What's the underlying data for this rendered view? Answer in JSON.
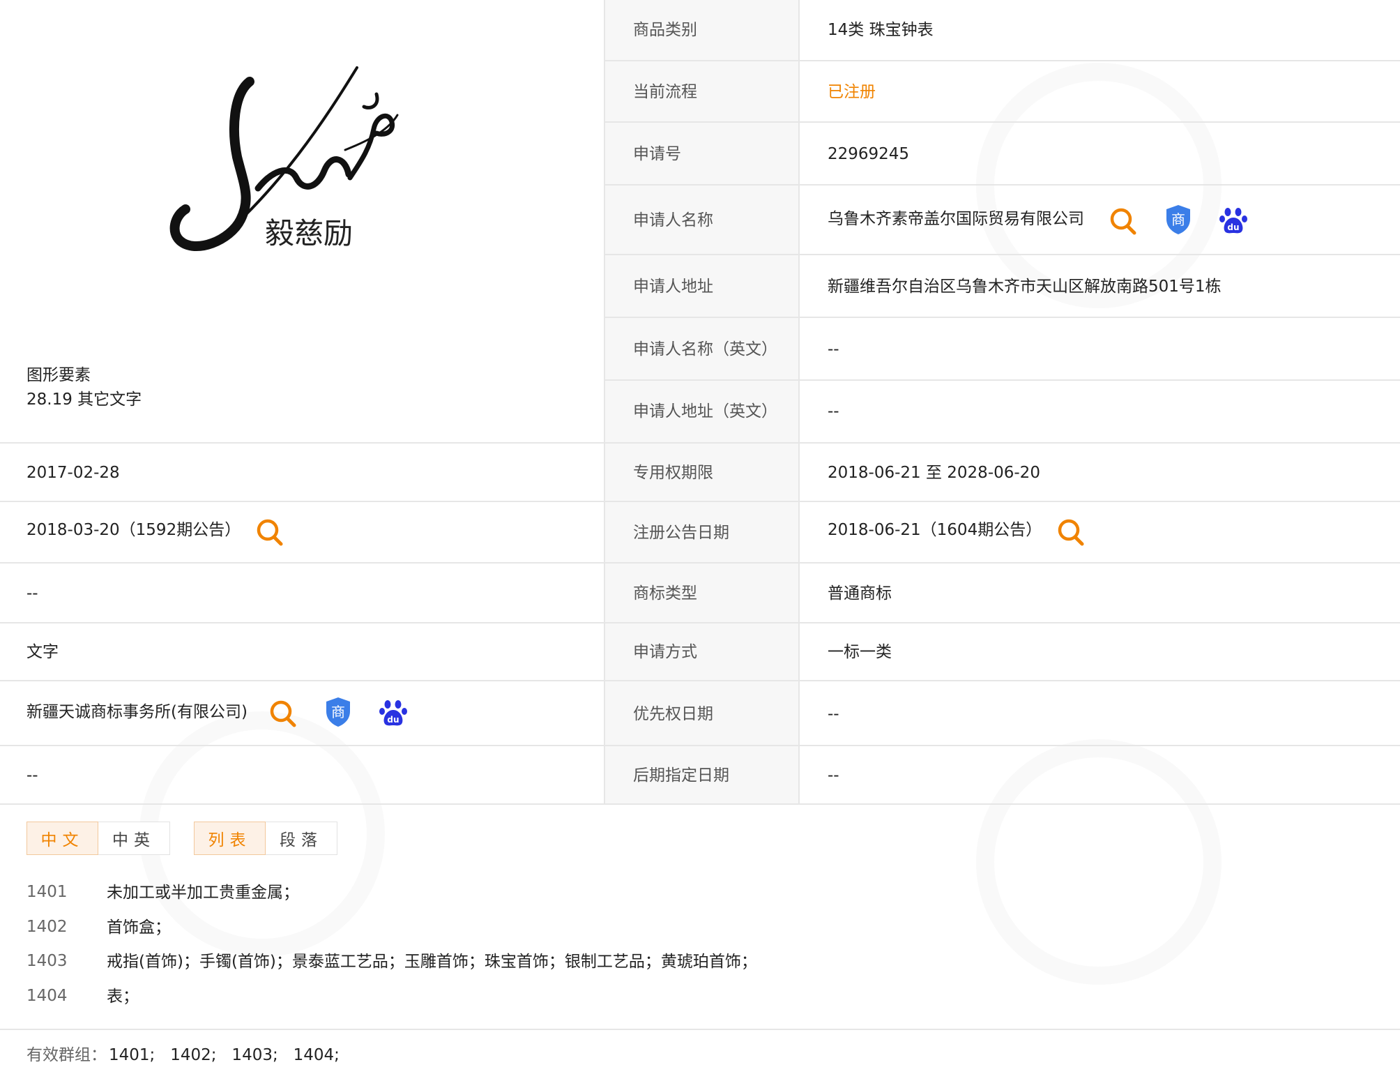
{
  "logo": {
    "text": "毅慈励"
  },
  "graphic_element": {
    "title": "图形要素",
    "value": "28.19 其它文字"
  },
  "right_rows": [
    {
      "label": "商品类别",
      "value": "14类 珠宝钟表"
    },
    {
      "label": "当前流程",
      "value": "已注册"
    },
    {
      "label": "申请号",
      "value": "22969245"
    },
    {
      "label": "申请人名称",
      "value": "乌鲁木齐素帝盖尔国际贸易有限公司"
    },
    {
      "label": "申请人地址",
      "value": "新疆维吾尔自治区乌鲁木齐市天山区解放南路501号1栋"
    },
    {
      "label": "申请人名称（英文）",
      "value": "--"
    },
    {
      "label": "申请人地址（英文）",
      "value": "--"
    },
    {
      "label": "专用权期限",
      "value": "2018-06-21 至 2028-06-20"
    },
    {
      "label": "注册公告日期",
      "value": "2018-06-21（1604期公告）"
    },
    {
      "label": "商标类型",
      "value": "普通商标"
    },
    {
      "label": "申请方式",
      "value": "一标一类"
    },
    {
      "label": "优先权日期",
      "value": "--"
    },
    {
      "label": "后期指定日期",
      "value": "--"
    }
  ],
  "left_rows": [
    {
      "value": "2017-02-28"
    },
    {
      "value": "2018-03-20（1592期公告）"
    },
    {
      "value": "--"
    },
    {
      "value": "文字"
    },
    {
      "value": "新疆天诚商标事务所(有限公司)"
    },
    {
      "value": "--"
    }
  ],
  "icons": {
    "search": "search-icon",
    "trademark": "trademark-shield-icon",
    "trademark_char": "商",
    "baidu": "baidu-paw-icon",
    "baidu_text": "du"
  },
  "tabs_lang": [
    {
      "label": "中文"
    },
    {
      "label": "中英"
    }
  ],
  "tabs_view": [
    {
      "label": "列表"
    },
    {
      "label": "段落"
    }
  ],
  "goods": [
    {
      "code": "1401",
      "text": "未加工或半加工贵重金属；"
    },
    {
      "code": "1402",
      "text": "首饰盒；"
    },
    {
      "code": "1403",
      "text": "戒指(首饰)；手镯(首饰)；景泰蓝工艺品；玉雕首饰；珠宝首饰；银制工艺品；黄琥珀首饰；"
    },
    {
      "code": "1404",
      "text": "表；"
    }
  ],
  "groups": {
    "label": "有效群组：",
    "value": "1401;   1402;   1403;   1404;"
  },
  "colors": {
    "accent": "#f08300",
    "shield": "#3b7ee8",
    "baidu": "#2932e1"
  }
}
